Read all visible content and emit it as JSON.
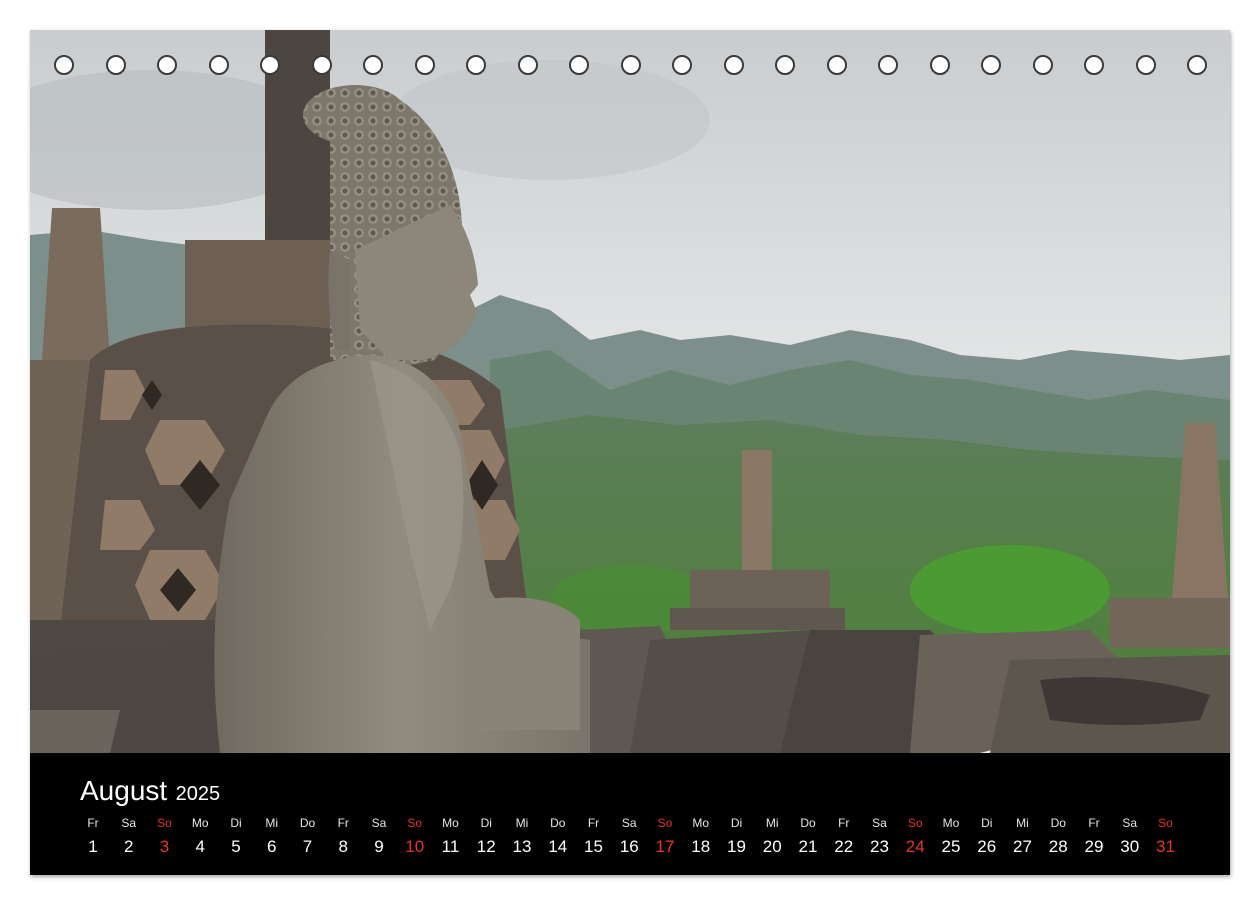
{
  "calendar": {
    "month": "August",
    "year": "2025",
    "holes_count": 23,
    "sunday_color": "#e8322b",
    "days": [
      {
        "weekday": "Fr",
        "day": "1"
      },
      {
        "weekday": "Sa",
        "day": "2"
      },
      {
        "weekday": "So",
        "day": "3"
      },
      {
        "weekday": "Mo",
        "day": "4"
      },
      {
        "weekday": "Di",
        "day": "5"
      },
      {
        "weekday": "Mi",
        "day": "6"
      },
      {
        "weekday": "Do",
        "day": "7"
      },
      {
        "weekday": "Fr",
        "day": "8"
      },
      {
        "weekday": "Sa",
        "day": "9"
      },
      {
        "weekday": "So",
        "day": "10"
      },
      {
        "weekday": "Mo",
        "day": "11"
      },
      {
        "weekday": "Di",
        "day": "12"
      },
      {
        "weekday": "Mi",
        "day": "13"
      },
      {
        "weekday": "Do",
        "day": "14"
      },
      {
        "weekday": "Fr",
        "day": "15"
      },
      {
        "weekday": "Sa",
        "day": "16"
      },
      {
        "weekday": "So",
        "day": "17"
      },
      {
        "weekday": "Mo",
        "day": "18"
      },
      {
        "weekday": "Di",
        "day": "19"
      },
      {
        "weekday": "Mi",
        "day": "20"
      },
      {
        "weekday": "Do",
        "day": "21"
      },
      {
        "weekday": "Fr",
        "day": "22"
      },
      {
        "weekday": "Sa",
        "day": "23"
      },
      {
        "weekday": "So",
        "day": "24"
      },
      {
        "weekday": "Mo",
        "day": "25"
      },
      {
        "weekday": "Di",
        "day": "26"
      },
      {
        "weekday": "Mi",
        "day": "27"
      },
      {
        "weekday": "Do",
        "day": "28"
      },
      {
        "weekday": "Fr",
        "day": "29"
      },
      {
        "weekday": "Sa",
        "day": "30"
      },
      {
        "weekday": "So",
        "day": "31"
      }
    ]
  }
}
